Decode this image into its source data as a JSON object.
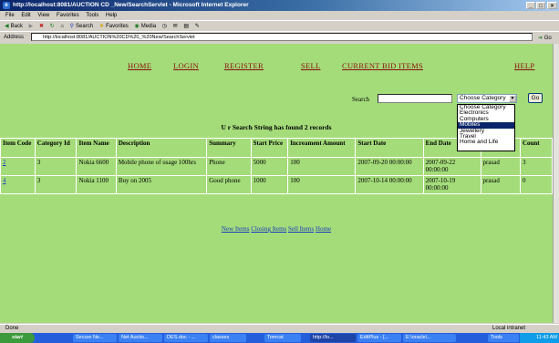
{
  "window": {
    "title": "http://localhost:8081/AUCTION CD _New/SearchServlet - Microsoft Internet Explorer"
  },
  "menu": [
    "File",
    "Edit",
    "View",
    "Favorites",
    "Tools",
    "Help"
  ],
  "toolbar": {
    "back": "Back",
    "search": "Search",
    "favorites": "Favorites",
    "media": "Media"
  },
  "address": {
    "label": "Address",
    "url": "http://localhost:8081/AUCTION%20CD%20_%20New/SearchServlet",
    "go": "Go"
  },
  "nav": [
    "HOME",
    "LOGIN",
    "REGISTER",
    "SELL",
    "CURRENT BID ITEMS",
    "HELP"
  ],
  "search": {
    "label": "Search",
    "selected": "Choose Category",
    "go": "Go",
    "options": [
      "Choose Category",
      "Electronics",
      "Computers",
      "Mobiles",
      "Jewellery",
      "Travel",
      "Home and Life"
    ],
    "highlighted_index": 3
  },
  "result_text": "U r Search String has found 2 records",
  "table": {
    "headers": [
      "Item Code",
      "Category Id",
      "Item Name",
      "Description",
      "Summary",
      "Start Price",
      "Increament Amount",
      "Start Date",
      "End Date",
      "",
      "Count"
    ],
    "rows": [
      [
        "2",
        "3",
        "Nokia 6600",
        "Mobile phone of usage 100hrs",
        "Phone",
        "5000",
        "100",
        "2007-09-20 00:00:00",
        "2007-09-22 00:00:00",
        "prasad",
        "3"
      ],
      [
        "4",
        "3",
        "Nokia 1100",
        "Buy on 2005",
        "Good phone",
        "1000",
        "100",
        "2007-10-14 00:00:00",
        "2007-10-19 00:00:00",
        "prasad",
        "0"
      ]
    ]
  },
  "footer_links": [
    "New Items",
    "Closing Items",
    "Sell Items",
    "Home"
  ],
  "status": {
    "left": "Done",
    "right": "Local intranet"
  },
  "taskbar": {
    "start": "start",
    "items": [
      "Secure Ne...",
      "Net Auctio...",
      "DES.doc - ...",
      "classes",
      "Tomcat",
      "http://lo...",
      "EditPlus - [...",
      "E:\\oracle\\...",
      "Tools"
    ],
    "clock": "11:43 AM"
  }
}
